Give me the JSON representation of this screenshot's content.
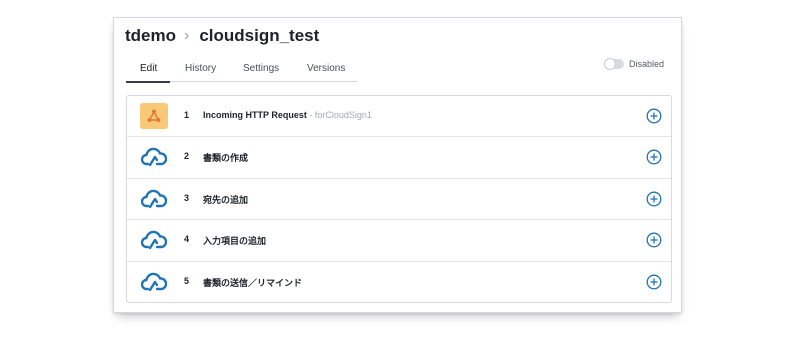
{
  "header": {
    "workspace": "tdemo",
    "separator": "›",
    "flow_name": "cloudsign_test"
  },
  "tabs": [
    {
      "label": "Edit",
      "active": true
    },
    {
      "label": "History",
      "active": false
    },
    {
      "label": "Settings",
      "active": false
    },
    {
      "label": "Versions",
      "active": false
    }
  ],
  "status_toggle": {
    "label": "Disabled",
    "enabled": false
  },
  "colors": {
    "accent": "#1f73b7",
    "http_icon_bg": "#f8c879",
    "http_icon_fg": "#e07b2e"
  },
  "steps": [
    {
      "number": "1",
      "name": "Incoming HTTP Request",
      "subtitle": " - forCloudSign1",
      "icon": "http-request-icon"
    },
    {
      "number": "2",
      "name": "書類の作成",
      "subtitle": "",
      "icon": "cloudsign-icon"
    },
    {
      "number": "3",
      "name": "宛先の追加",
      "subtitle": "",
      "icon": "cloudsign-icon"
    },
    {
      "number": "4",
      "name": "入力項目の追加",
      "subtitle": "",
      "icon": "cloudsign-icon"
    },
    {
      "number": "5",
      "name": "書類の送信／リマインド",
      "subtitle": "",
      "icon": "cloudsign-icon"
    }
  ]
}
